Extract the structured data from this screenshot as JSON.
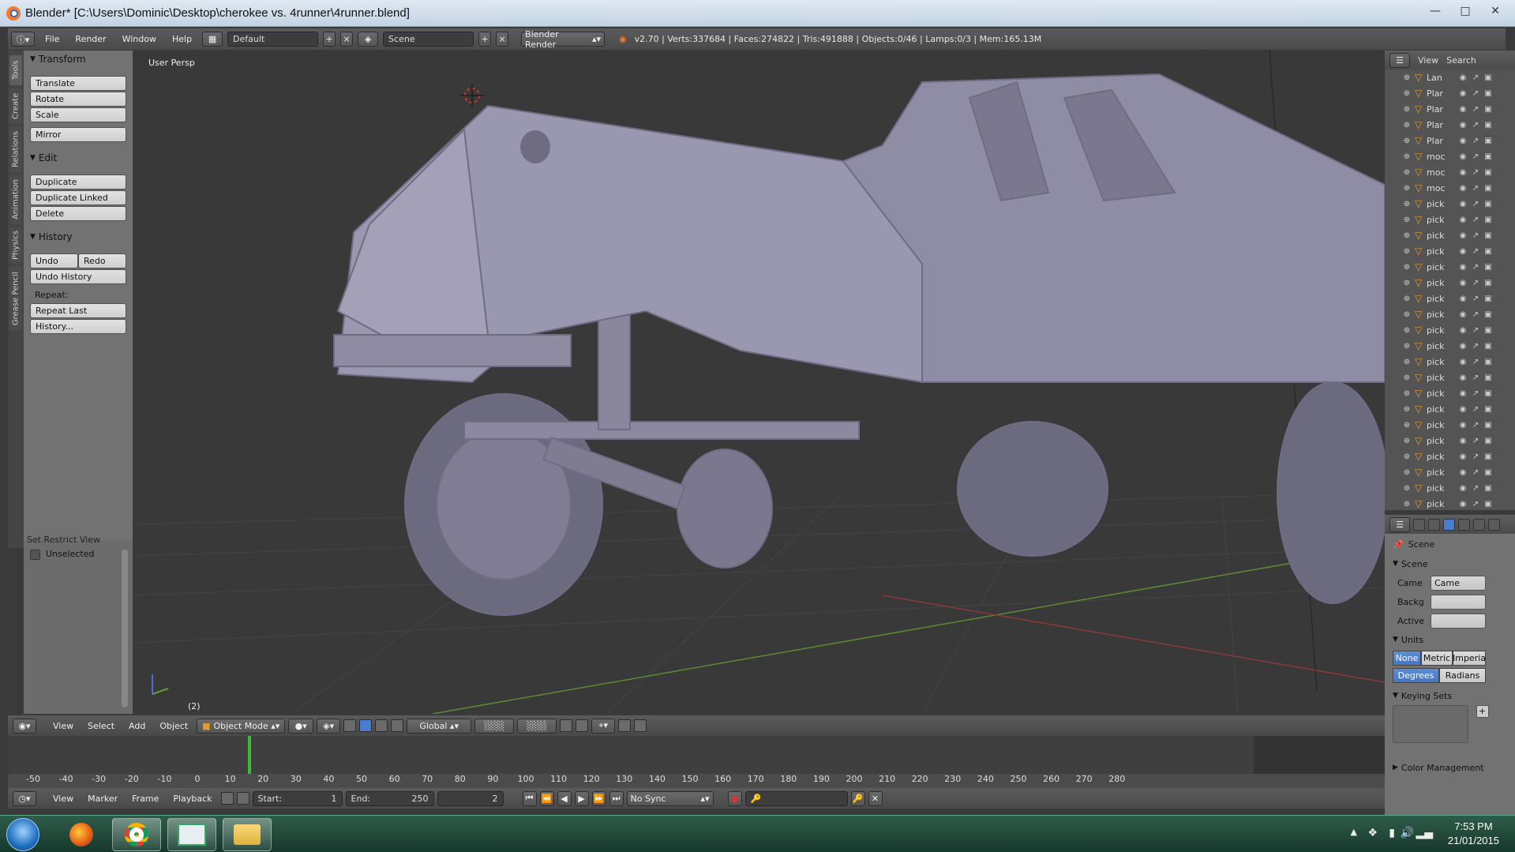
{
  "window": {
    "title": "Blender* [C:\\Users\\Dominic\\Desktop\\cherokee vs. 4runner\\4runner.blend]",
    "controls": [
      "minimize-icon",
      "maximize-icon",
      "close-icon"
    ]
  },
  "info_header": {
    "menus": [
      "File",
      "Render",
      "Window",
      "Help"
    ],
    "screen_layout": "Default",
    "scene": "Scene",
    "render_engine": "Blender Render",
    "stats": "v2.70 | Verts:337684 | Faces:274822 | Tris:491888 | Objects:0/46 | Lamps:0/3 | Mem:165.13M"
  },
  "tool_tabs": [
    "Tools",
    "Create",
    "Relations",
    "Animation",
    "Physics",
    "Grease Pencil"
  ],
  "tool_shelf": {
    "transform_title": "Transform",
    "translate": "Translate",
    "rotate": "Rotate",
    "scale": "Scale",
    "mirror": "Mirror",
    "edit_title": "Edit",
    "duplicate": "Duplicate",
    "duplicate_linked": "Duplicate Linked",
    "delete": "Delete",
    "history_title": "History",
    "undo": "Undo",
    "redo": "Redo",
    "undo_history": "Undo History",
    "repeat_label": "Repeat:",
    "repeat_last": "Repeat Last",
    "history_menu": "History...",
    "restrict_title": "Set Restrict View",
    "unselected": "Unselected"
  },
  "viewport": {
    "view_label": "User Persp",
    "frame_label": "(2)"
  },
  "outliner": {
    "view": "View",
    "search": "Search",
    "rows": [
      "Lan",
      "Plar",
      "Plar",
      "Plar",
      "Plar",
      "moc",
      "moc",
      "moc",
      "pick",
      "pick",
      "pick",
      "pick",
      "pick",
      "pick",
      "pick",
      "pick",
      "pick",
      "pick",
      "pick",
      "pick",
      "pick",
      "pick",
      "pick",
      "pick",
      "pick",
      "pick",
      "pick",
      "pick"
    ]
  },
  "properties": {
    "context": "Scene",
    "scene_section": "Scene",
    "camera_label": "Came",
    "camera_value": "Came",
    "background_label": "Backg",
    "active_label": "Active",
    "units_section": "Units",
    "unit_none": "None",
    "unit_metric": "Metric",
    "unit_imperial": "Imperia",
    "degrees": "Degrees",
    "radians": "Radians",
    "keying_section": "Keying Sets",
    "color_mgmt": "Color Management"
  },
  "view3d_header": {
    "menus": [
      "View",
      "Select",
      "Add",
      "Object"
    ],
    "mode": "Object Mode",
    "orientation": "Global"
  },
  "timeline": {
    "ticks": [
      "-50",
      "-40",
      "-30",
      "-20",
      "-10",
      "0",
      "10",
      "20",
      "30",
      "40",
      "50",
      "60",
      "70",
      "80",
      "90",
      "100",
      "110",
      "120",
      "130",
      "140",
      "150",
      "160",
      "170",
      "180",
      "190",
      "200",
      "210",
      "220",
      "230",
      "240",
      "250",
      "260",
      "270",
      "280"
    ],
    "current_frame": 2
  },
  "timeline_header": {
    "menus": [
      "View",
      "Marker",
      "Frame",
      "Playback"
    ],
    "start": "Start:",
    "start_value": "1",
    "end": "End:",
    "end_value": "250",
    "current": "2",
    "sync": "No Sync"
  },
  "taskbar": {
    "time": "7:53 PM",
    "date": "21/01/2015"
  },
  "colors": {
    "accent_blue": "#4a7cd0",
    "timeline_green": "#3cbc37",
    "mesh_orange": "#e89a2a"
  }
}
